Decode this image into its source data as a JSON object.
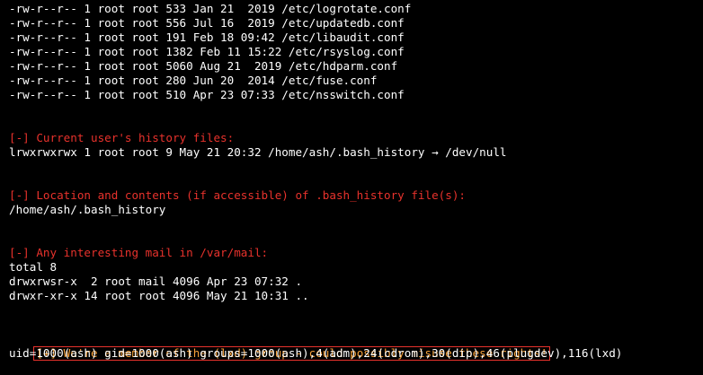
{
  "colors": {
    "background": "#000000",
    "text": "#ffffff",
    "warning_header": "#e8322c",
    "highlight_header": "#f5a03a",
    "highlight_box": "#e8322c"
  },
  "conf_files": [
    "-rw-r--r-- 1 root root 533 Jan 21  2019 /etc/logrotate.conf",
    "-rw-r--r-- 1 root root 556 Jul 16  2019 /etc/updatedb.conf",
    "-rw-r--r-- 1 root root 191 Feb 18 09:42 /etc/libaudit.conf",
    "-rw-r--r-- 1 root root 1382 Feb 11 15:22 /etc/rsyslog.conf",
    "-rw-r--r-- 1 root root 5060 Aug 21  2019 /etc/hdparm.conf",
    "-rw-r--r-- 1 root root 280 Jun 20  2014 /etc/fuse.conf",
    "-rw-r--r-- 1 root root 510 Apr 23 07:33 /etc/nsswitch.conf"
  ],
  "history_section": {
    "header": "[-] Current user's history files:",
    "line": "lrwxrwxrwx 1 root root 9 May 21 20:32 /home/ash/.bash_history → /dev/null"
  },
  "bash_history_section": {
    "header": "[-] Location and contents (if accessible) of .bash_history file(s):",
    "line": "/home/ash/.bash_history"
  },
  "mail_section": {
    "header": "[-] Any interesting mail in /var/mail:",
    "lines": [
      "total 8",
      "drwxrwsr-x  2 root mail 4096 Apr 23 07:32 .",
      "drwxr-xr-x 14 root root 4096 May 21 10:31 .."
    ]
  },
  "lxd_section": {
    "header": "[+] We're a member of the (lxd) group - could possibly misuse these rights!",
    "line": "uid=1000(ash) gid=1000(ash) groups=1000(ash),4(adm),24(cdrom),30(dip),46(plugdev),116(lxd)"
  }
}
